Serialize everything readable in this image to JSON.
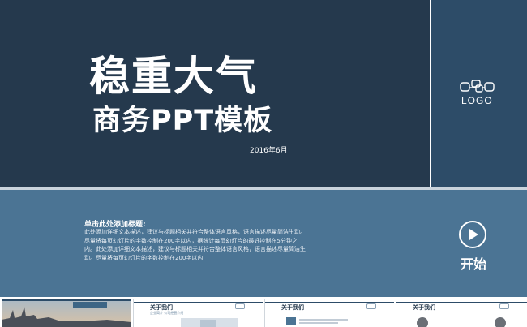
{
  "slide": {
    "title_line1": "稳重大气",
    "title_line2": "商务PPT模板",
    "date": "2016年6月",
    "logo_text": "LOGO",
    "section_heading": "单击此处添加标题:",
    "section_body": "此处添加详细文本描述，建议与标题相关并符合整体语言风格，语言描述尽量简洁生动。尽量将每页幻灯片的字数控制在200字以内，据统计每页幻灯片的最好控制在5分钟之内。此处添加详细文本描述，建议与标题相关并符合整体语言风格，语言描述尽量简洁生动。尽量将每页幻灯片的字数控制在200字以内",
    "start_label": "开始"
  },
  "thumbnails": [
    {
      "title": "",
      "subtitle": ""
    },
    {
      "title": "关于我们",
      "subtitle": "企业简介 公司经营介绍"
    },
    {
      "title": "关于我们",
      "subtitle": ""
    },
    {
      "title": "关于我们",
      "subtitle": ""
    }
  ],
  "colors": {
    "hero_dark": "#25394d",
    "hero_side": "#2d4c68",
    "band": "#4b7494"
  },
  "icons": [
    "logo-icon",
    "play-icon",
    "mini-logo-icon"
  ]
}
